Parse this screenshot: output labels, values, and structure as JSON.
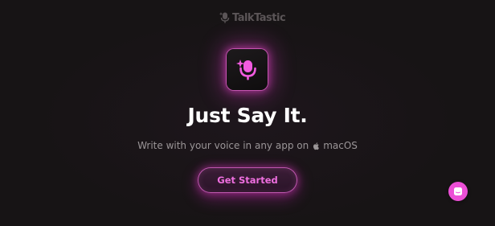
{
  "header": {
    "brand_name": "TalkTastic",
    "logo_icon": "microphone-sparkle-icon",
    "logo_color": "#5b5557"
  },
  "hero": {
    "app_icon": "microphone-sparkle-icon",
    "headline": "Just Say It.",
    "subtitle_prefix": "Write with your voice in any app on",
    "platform_icon": "apple-icon",
    "platform_name": "macOS"
  },
  "cta": {
    "label": "Get Started"
  },
  "chat_widget": {
    "icon": "chat-icon"
  },
  "colors": {
    "background": "#171415",
    "accent": "#ec4fd6",
    "accent_text": "#ef6fe0",
    "headline": "#ffffff",
    "subtitle": "#9a9597"
  }
}
